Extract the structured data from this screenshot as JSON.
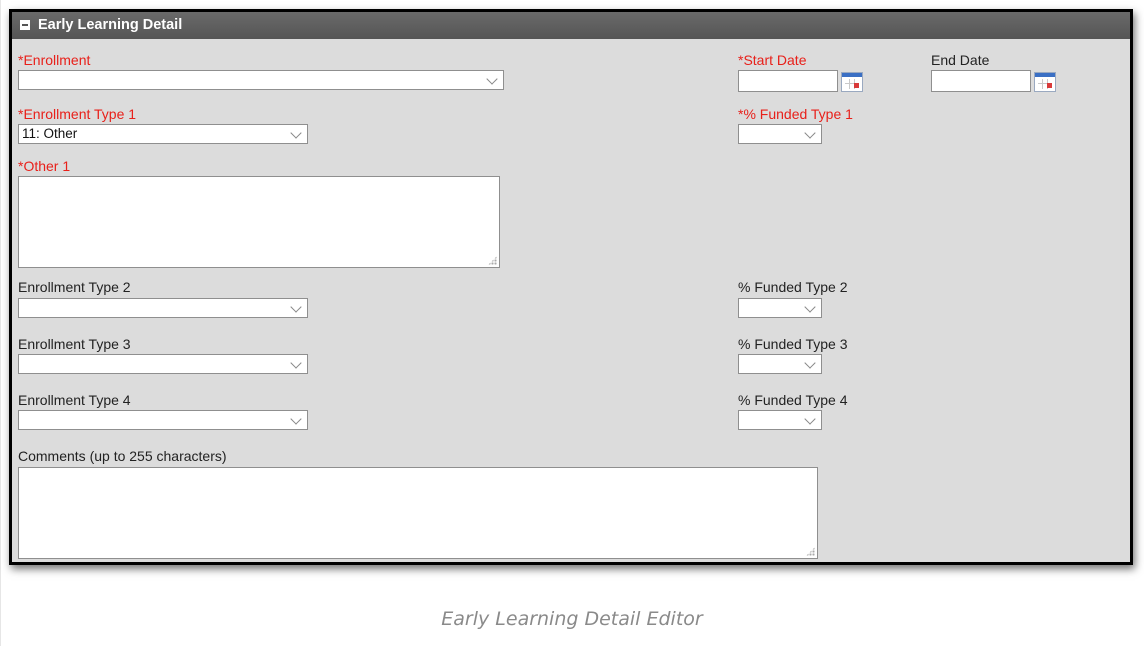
{
  "panel": {
    "title": "Early Learning Detail"
  },
  "fields": {
    "enrollment": {
      "label": "*Enrollment",
      "value": ""
    },
    "start_date": {
      "label": "*Start Date",
      "value": ""
    },
    "end_date": {
      "label": "End Date",
      "value": ""
    },
    "enrollment_type_1": {
      "label": "*Enrollment Type 1",
      "value": "11: Other"
    },
    "funded_type_1": {
      "label": "*% Funded Type 1",
      "value": ""
    },
    "other_1": {
      "label": "*Other 1",
      "value": ""
    },
    "enrollment_type_2": {
      "label": "Enrollment Type 2",
      "value": ""
    },
    "funded_type_2": {
      "label": "% Funded Type 2",
      "value": ""
    },
    "enrollment_type_3": {
      "label": "Enrollment Type 3",
      "value": ""
    },
    "funded_type_3": {
      "label": "% Funded Type 3",
      "value": ""
    },
    "enrollment_type_4": {
      "label": "Enrollment Type 4",
      "value": ""
    },
    "funded_type_4": {
      "label": "% Funded Type 4",
      "value": ""
    },
    "comments": {
      "label": "Comments (up to 255 characters)",
      "value": ""
    }
  },
  "caption": "Early Learning Detail Editor",
  "colors": {
    "required_label": "#e8201a",
    "header_bg": "#5f5f5f",
    "panel_bg": "#dcdcdc"
  }
}
